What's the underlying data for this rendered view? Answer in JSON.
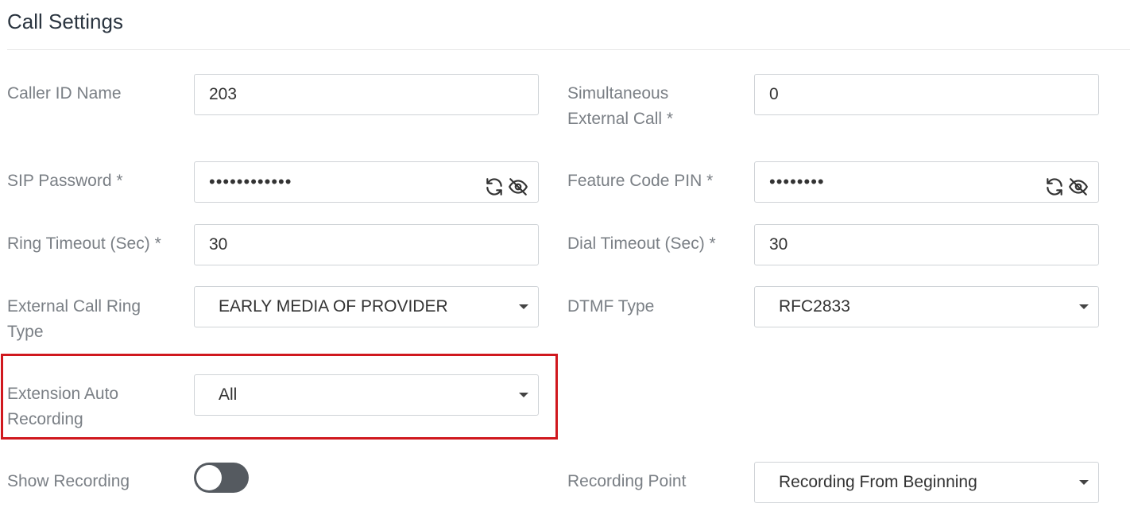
{
  "section": {
    "title": "Call Settings"
  },
  "fields": {
    "caller_id_name": {
      "label": "Caller ID Name",
      "value": "203"
    },
    "simultaneous_external_call": {
      "label_line1": "Simultaneous",
      "label_line2": "External Call *",
      "value": "0"
    },
    "sip_password": {
      "label": "SIP Password *",
      "value": "••••••••••••"
    },
    "feature_code_pin": {
      "label": "Feature Code PIN *",
      "value": "••••••••"
    },
    "ring_timeout": {
      "label": "Ring Timeout (Sec) *",
      "value": "30"
    },
    "dial_timeout": {
      "label": "Dial Timeout (Sec) *",
      "value": "30"
    },
    "external_call_ring_type": {
      "label_line1": "External Call Ring",
      "label_line2": "Type",
      "value": "EARLY MEDIA OF PROVIDER"
    },
    "dtmf_type": {
      "label": "DTMF Type",
      "value": "RFC2833"
    },
    "extension_auto_recording": {
      "label_line1": "Extension Auto",
      "label_line2": "Recording",
      "value": "All"
    },
    "show_recording": {
      "label": "Show Recording",
      "state": "off"
    },
    "recording_point": {
      "label": "Recording Point",
      "value": "Recording From Beginning"
    }
  },
  "icons": {
    "refresh": "refresh-icon",
    "eye_off": "eye-off-icon",
    "dropdown": "chevron-down-icon"
  },
  "colors": {
    "highlight_border": "#d0181e",
    "toggle_off": "#555a60"
  }
}
